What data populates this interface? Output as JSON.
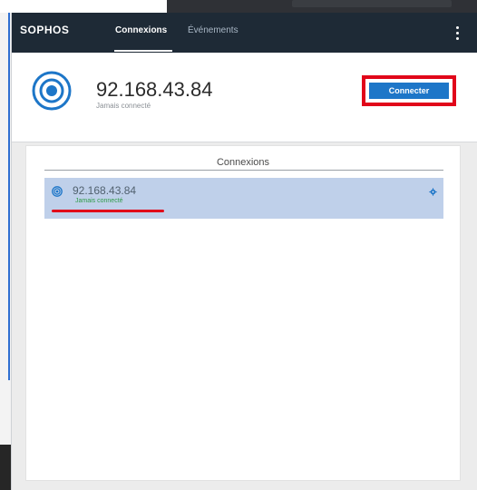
{
  "app": {
    "brand": "SOPHOS",
    "tabs": [
      {
        "label": "Connexions",
        "active": true
      },
      {
        "label": "Événements",
        "active": false
      }
    ]
  },
  "header": {
    "ip": "92.168.43.84",
    "status": "Jamais connecté",
    "connect_label": "Connecter"
  },
  "connections": {
    "title": "Connexions",
    "items": [
      {
        "ip": "92.168.43.84",
        "status": "Jamais connecté"
      }
    ]
  },
  "icons": {
    "connection": "target-icon",
    "settings": "gear-icon",
    "menu": "kebab-menu-icon"
  },
  "colors": {
    "topbar": "#1e2a36",
    "primary": "#1d76c8",
    "highlight": "#bfd0ea",
    "alert": "#e1061a",
    "status_green": "#2f9b48"
  }
}
